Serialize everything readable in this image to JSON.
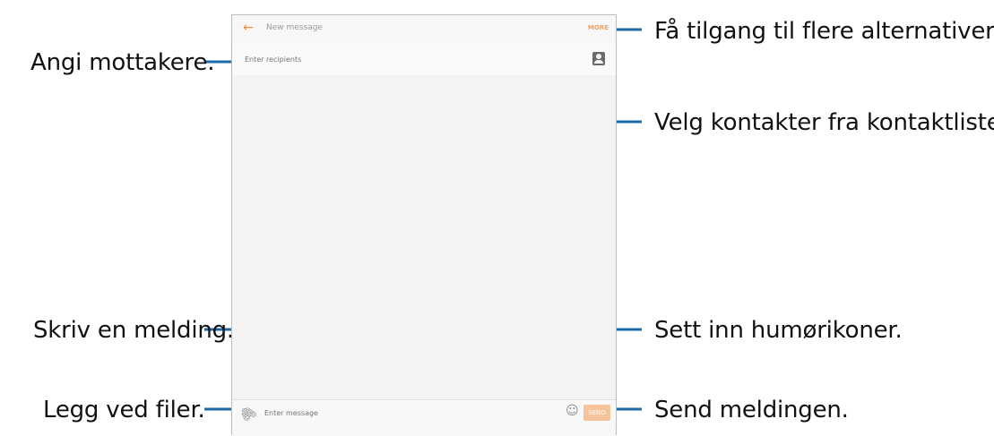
{
  "screen": {
    "title": "New message",
    "more_label": "MORE",
    "recipient_placeholder": "Enter recipients",
    "message_placeholder": "Enter message",
    "send_label": "SEND"
  },
  "callouts": {
    "more_options": "Få tilgang til flere alternativer.",
    "enter_recipients": "Angi mottakere.",
    "select_contacts": "Velg kontakter fra kontaktlisten.",
    "write_message": "Skriv en melding.",
    "insert_emoticons": "Sett inn humørikoner.",
    "attach_files": "Legg ved filer.",
    "send_message": "Send meldingen."
  },
  "colors": {
    "leader_line": "#1e6aa8",
    "accent": "#f08a3c",
    "send_button": "#f6c49a"
  },
  "icons": [
    "back-arrow-icon",
    "contact-icon",
    "paperclip-icon",
    "emoticon-icon"
  ]
}
